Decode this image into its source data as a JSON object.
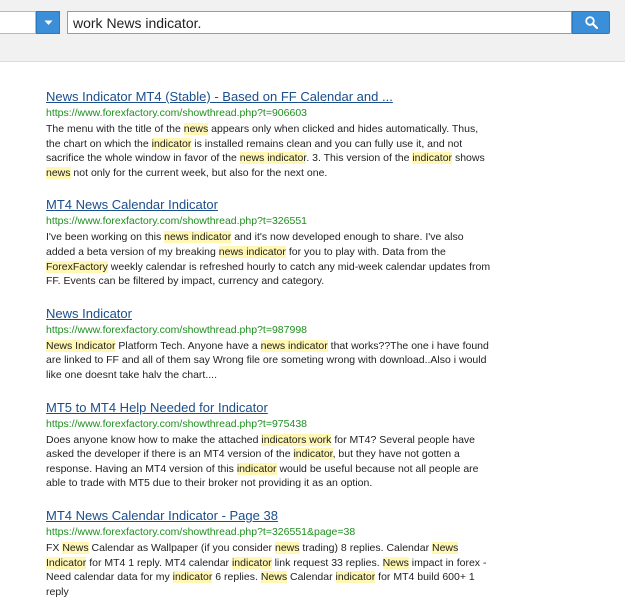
{
  "search": {
    "query": "work News indicator."
  },
  "results": [
    {
      "title": "News Indicator MT4 (Stable) - Based on FF Calendar and ...",
      "url": "https://www.forexfactory.com/showthread.php?t=906603",
      "snippet": [
        {
          "t": "The menu with the title of the "
        },
        {
          "t": "news",
          "h": true
        },
        {
          "t": " appears only when clicked and hides automatically. Thus, the chart on which the "
        },
        {
          "t": "indicator",
          "h": true
        },
        {
          "t": " is installed remains clean and you can fully use it, and not sacrifice the whole window in favor of the "
        },
        {
          "t": "news indicator",
          "h": true
        },
        {
          "t": ". 3. This version of the "
        },
        {
          "t": "indicator",
          "h": true
        },
        {
          "t": " shows "
        },
        {
          "t": "news",
          "h": true
        },
        {
          "t": " not only for the current week, but also for the next one."
        }
      ]
    },
    {
      "title": "MT4 News Calendar Indicator",
      "url": "https://www.forexfactory.com/showthread.php?t=326551",
      "snippet": [
        {
          "t": "I've been working on this "
        },
        {
          "t": "news indicator",
          "h": true
        },
        {
          "t": " and it's now developed enough to share. I've also added a beta version of my breaking "
        },
        {
          "t": "news indicator",
          "h": true
        },
        {
          "t": " for you to play with. Data from the "
        },
        {
          "t": "ForexFactory",
          "h": true
        },
        {
          "t": " weekly calendar is refreshed hourly to catch any mid-week calendar updates from FF. Events can be filtered by impact, currency and category."
        }
      ]
    },
    {
      "title": "News Indicator",
      "url": "https://www.forexfactory.com/showthread.php?t=987998",
      "snippet": [
        {
          "t": "News Indicator",
          "h": true
        },
        {
          "t": " Platform Tech. Anyone have a "
        },
        {
          "t": "news indicator",
          "h": true
        },
        {
          "t": " that works??The one i have found are linked to FF and all of them say Wrong file ore someting wrong with download..Also i would like one doesnt take halv the chart...."
        }
      ]
    },
    {
      "title": "MT5 to MT4 Help Needed for Indicator",
      "url": "https://www.forexfactory.com/showthread.php?t=975438",
      "snippet": [
        {
          "t": "Does anyone know how to make the attached "
        },
        {
          "t": "indicators work",
          "h": true
        },
        {
          "t": " for MT4? Several people have asked the developer if there is an MT4 version of the "
        },
        {
          "t": "indicator",
          "h": true
        },
        {
          "t": ", but they have not gotten a response. Having an MT4 version of this "
        },
        {
          "t": "indicator",
          "h": true
        },
        {
          "t": " would be useful because not all people are able to trade with MT5 due to their broker not providing it as an option."
        }
      ]
    },
    {
      "title": "MT4 News Calendar Indicator - Page 38",
      "url": "https://www.forexfactory.com/showthread.php?t=326551&page=38",
      "snippet": [
        {
          "t": "FX "
        },
        {
          "t": "News",
          "h": true
        },
        {
          "t": " Calendar as Wallpaper (if you consider "
        },
        {
          "t": "news",
          "h": true
        },
        {
          "t": " trading) 8 replies. Calendar "
        },
        {
          "t": "News Indicator",
          "h": true
        },
        {
          "t": " for MT4 1 reply. MT4 calendar "
        },
        {
          "t": "indicator",
          "h": true
        },
        {
          "t": " link request 33 replies. "
        },
        {
          "t": "News",
          "h": true
        },
        {
          "t": " impact in forex - Need calendar data for my "
        },
        {
          "t": "indicator",
          "h": true
        },
        {
          "t": " 6 replies. "
        },
        {
          "t": "News",
          "h": true
        },
        {
          "t": " Calendar "
        },
        {
          "t": "indicator",
          "h": true
        },
        {
          "t": " for MT4 build 600+ 1 reply"
        }
      ]
    }
  ]
}
